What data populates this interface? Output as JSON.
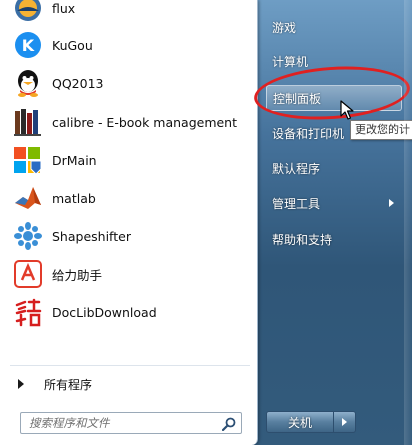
{
  "programs": [
    {
      "label": "flux",
      "icon": "flux-icon"
    },
    {
      "label": "KuGou",
      "icon": "kugou-icon"
    },
    {
      "label": "QQ2013",
      "icon": "qq-icon"
    },
    {
      "label": "calibre - E-book management",
      "icon": "calibre-icon"
    },
    {
      "label": "DrMain",
      "icon": "drmain-icon"
    },
    {
      "label": "matlab",
      "icon": "matlab-icon"
    },
    {
      "label": "Shapeshifter",
      "icon": "shapeshifter-icon"
    },
    {
      "label": "给力助手",
      "icon": "geili-icon"
    },
    {
      "label": "DocLibDownload",
      "icon": "doclib-icon"
    }
  ],
  "all_programs": "所有程序",
  "search": {
    "placeholder": "搜索程序和文件",
    "value": ""
  },
  "right_items": [
    {
      "label": "游戏"
    },
    {
      "label": "计算机"
    },
    {
      "label": "控制面板"
    },
    {
      "label": "设备和打印机"
    },
    {
      "label": "默认程序"
    },
    {
      "label": "管理工具"
    },
    {
      "label": "帮助和支持"
    }
  ],
  "tooltip": "更改您的计",
  "shutdown": {
    "label": "关机"
  },
  "colors": {
    "highlight_ellipse": "#e02020",
    "accent_blue": "#2f5678"
  }
}
